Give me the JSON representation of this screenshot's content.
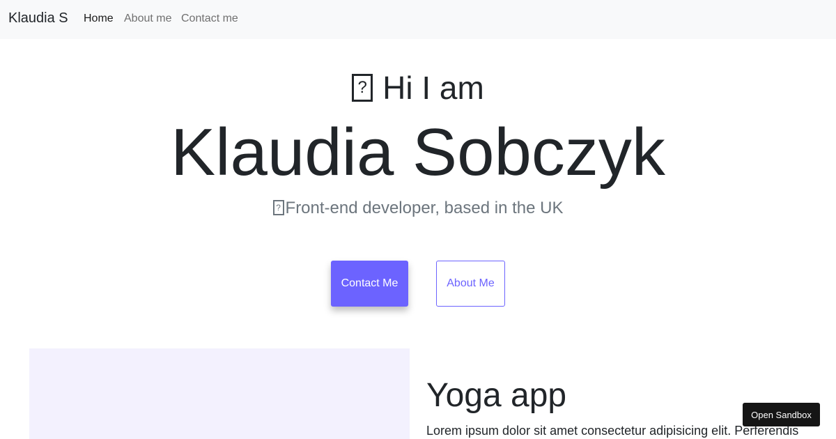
{
  "navbar": {
    "brand": "Klaudia S",
    "links": [
      {
        "label": "Home",
        "active": true
      },
      {
        "label": "About me",
        "active": false
      },
      {
        "label": "Contact me",
        "active": false
      }
    ]
  },
  "hero": {
    "greeting": "Hi I am",
    "greeting_icon": "missing-glyph-icon",
    "name": "Klaudia Sobczyk",
    "tagline": "Front-end developer, based in the UK",
    "tagline_icon": "missing-glyph-icon",
    "primary_button": "Contact Me",
    "secondary_button": "About Me"
  },
  "project": {
    "title": "Yoga app",
    "description": "Lorem ipsum dolor sit amet consectetur adipisicing elit. Perferendis"
  },
  "sandbox_button": "Open Sandbox",
  "colors": {
    "accent": "#6c63ff",
    "navbar_bg": "#f8f9fa",
    "project_image_bg": "#f3f1fe",
    "sandbox_bg": "#151515"
  }
}
